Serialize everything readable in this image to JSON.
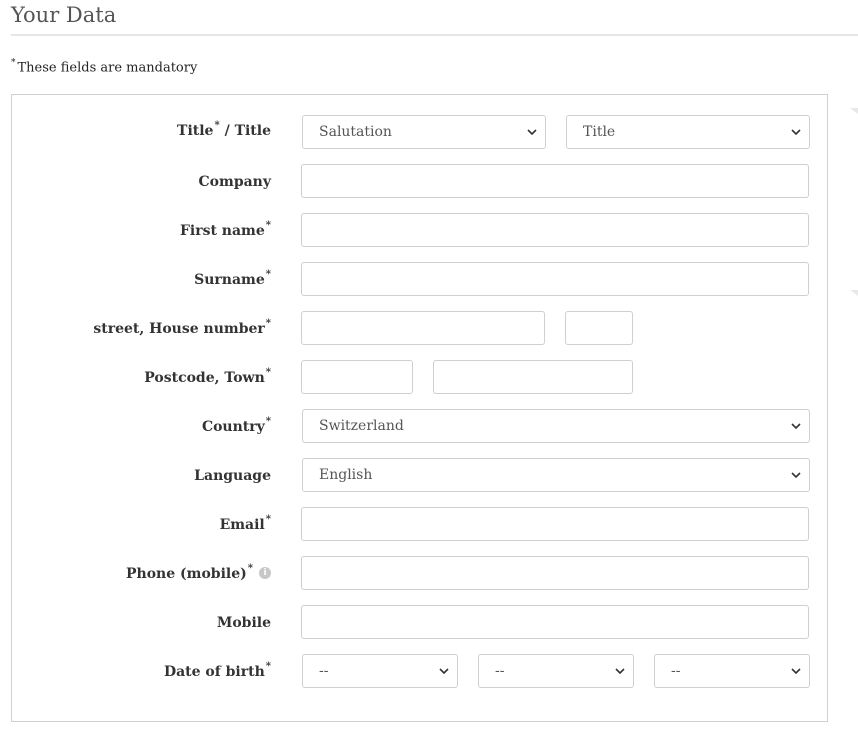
{
  "page": {
    "heading": "Your Data",
    "mandatory_note": "These fields are mandatory",
    "mandatory_symbol": "*"
  },
  "form": {
    "title_label": "Title",
    "title_label_suffix": " / Title",
    "salutation_value": "Salutation",
    "academic_title_value": "Title",
    "company_label": "Company",
    "first_name_label": "First name",
    "surname_label": "Surname",
    "street_label": "street, House number",
    "postcode_label": "Postcode, Town",
    "country_label": "Country",
    "country_value": "Switzerland",
    "language_label": "Language",
    "language_value": "English",
    "email_label": "Email",
    "phone_label": "Phone (mobile)",
    "mobile_label": "Mobile",
    "dob_label": "Date of birth",
    "dob_day_value": "--",
    "dob_month_value": "--",
    "dob_year_value": "--",
    "info_icon": "info-icon",
    "chevron_icon": "chevron-down-icon"
  }
}
